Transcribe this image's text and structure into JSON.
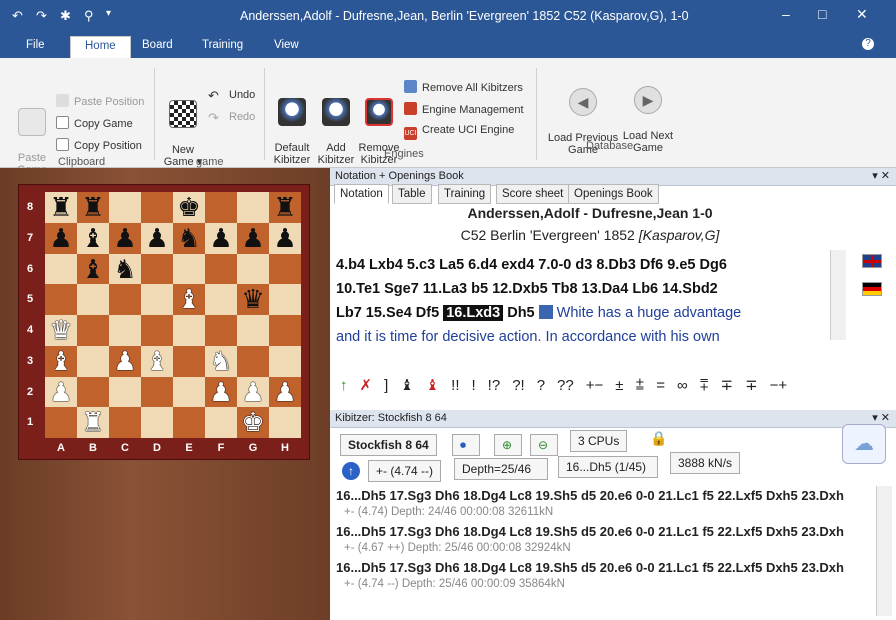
{
  "window": {
    "title": "Anderssen,Adolf - Dufresne,Jean, Berlin 'Evergreen' 1852  C52  (Kasparov,G), 1-0",
    "minimize": "–",
    "maximize": "□",
    "close": "✕",
    "help": "?"
  },
  "quick_access": {
    "undo": "↶",
    "redo": "↷",
    "bug": "✱",
    "pin": "⚲",
    "more": "▾"
  },
  "menu_tabs": [
    "File",
    "Home",
    "Board",
    "Training",
    "View"
  ],
  "ribbon": {
    "clipboard": {
      "paste_game": "Paste\nGame",
      "paste_position": "Paste Position",
      "copy_game": "Copy Game",
      "copy_position": "Copy Position",
      "group": "Clipboard"
    },
    "game": {
      "new_game": "New\nGame ▾",
      "undo": "Undo",
      "redo": "Redo",
      "group": "game"
    },
    "engines": {
      "default_kibitzer": "Default\nKibitzer",
      "add_kibitzer": "Add\nKibitzer",
      "remove_kibitzer": "Remove\nKibitzer",
      "remove_all": "Remove All Kibitzers",
      "engine_management": "Engine Management",
      "create_uci": "Create UCI Engine",
      "group": "Engines"
    },
    "database": {
      "load_prev": "Load Previous\nGame",
      "load_next": "Load Next\nGame",
      "group": "Database"
    }
  },
  "board": {
    "ranks": [
      "8",
      "7",
      "6",
      "5",
      "4",
      "3",
      "2",
      "1"
    ],
    "files": [
      "A",
      "B",
      "C",
      "D",
      "E",
      "F",
      "G",
      "H"
    ],
    "position": [
      [
        "r",
        "r",
        "",
        "",
        "k",
        "",
        "",
        "r"
      ],
      [
        "p",
        "b",
        "p",
        "p",
        "n",
        "p",
        "p",
        "p"
      ],
      [
        "",
        "b",
        "n",
        "",
        "",
        "",
        "",
        ""
      ],
      [
        "",
        "",
        "",
        "",
        "B",
        "",
        "q",
        ""
      ],
      [
        "Q",
        "",
        "",
        "",
        "",
        "",
        "",
        ""
      ],
      [
        "B",
        "",
        "P",
        "B",
        "",
        "N",
        "",
        ""
      ],
      [
        "P",
        "",
        "",
        "",
        "",
        "P",
        "P",
        "P"
      ],
      [
        "",
        "R",
        "",
        "",
        "",
        "",
        "K",
        ""
      ]
    ]
  },
  "notation_panel": {
    "title": "Notation + Openings Book",
    "tabs": [
      "Notation",
      "Table",
      "Training",
      "Score sheet",
      "Openings Book"
    ],
    "players": "Anderssen,Adolf - Dufresne,Jean  1-0",
    "event": "C52 Berlin 'Evergreen' 1852 ",
    "annotator": "[Kasparov,G]",
    "moves_a": "4.b4  Lxb4  5.c3  La5  6.d4  exd4  7.0-0  d3  8.Db3  Df6  9.e5  Dg6",
    "moves_b": "10.Te1  Sge7  11.La3  b5  12.Dxb5  Tb8  13.Da4  Lb6  14.Sbd2",
    "moves_c": "Lb7  15.Se4  Df5 ",
    "current_move": "16.Lxd3",
    "after_move": " Dh5 ",
    "comment_1": "White has a huge advantage",
    "comment_2": "and it is time for decisive action. In accordance with his own",
    "annotations": [
      "↑",
      "✗",
      "]",
      "♝",
      "♝",
      "!!",
      "!",
      "!?",
      "?!",
      "?",
      "??",
      "+−",
      "±",
      "⩲",
      "=",
      "∞",
      "⩱",
      "∓",
      "∓",
      "−+"
    ]
  },
  "kibitzer": {
    "title": "Kibitzer: Stockfish 8 64",
    "engine": "Stockfish 8 64",
    "cpus": "3 CPUs",
    "eval": "+- (4.74 --)",
    "depth": "Depth=25/46",
    "line": "16...Dh5 (1/45)",
    "speed": "3888 kN/s",
    "lines": [
      {
        "moves": "16...Dh5 17.Sg3 Dh6 18.Dg4 Lc8 19.Sh5 d5 20.e6 0-0 21.Lc1 f5 22.Lxf5 Dxh5 23.Dxh",
        "info": "+- (4.74)  Depth: 24/46   00:00:08  32611kN"
      },
      {
        "moves": "16...Dh5 17.Sg3 Dh6 18.Dg4 Lc8 19.Sh5 d5 20.e6 0-0 21.Lc1 f5 22.Lxf5 Dxh5 23.Dxh",
        "info": "+- (4.67 ++)  Depth: 25/46   00:00:08  32924kN"
      },
      {
        "moves": "16...Dh5 17.Sg3 Dh6 18.Dg4 Lc8 19.Sh5 d5 20.e6 0-0 21.Lc1 f5 22.Lxf5 Dxh5 23.Dxh",
        "info": "+- (4.74 --)  Depth: 25/46   00:00:09  35864kN"
      }
    ]
  }
}
